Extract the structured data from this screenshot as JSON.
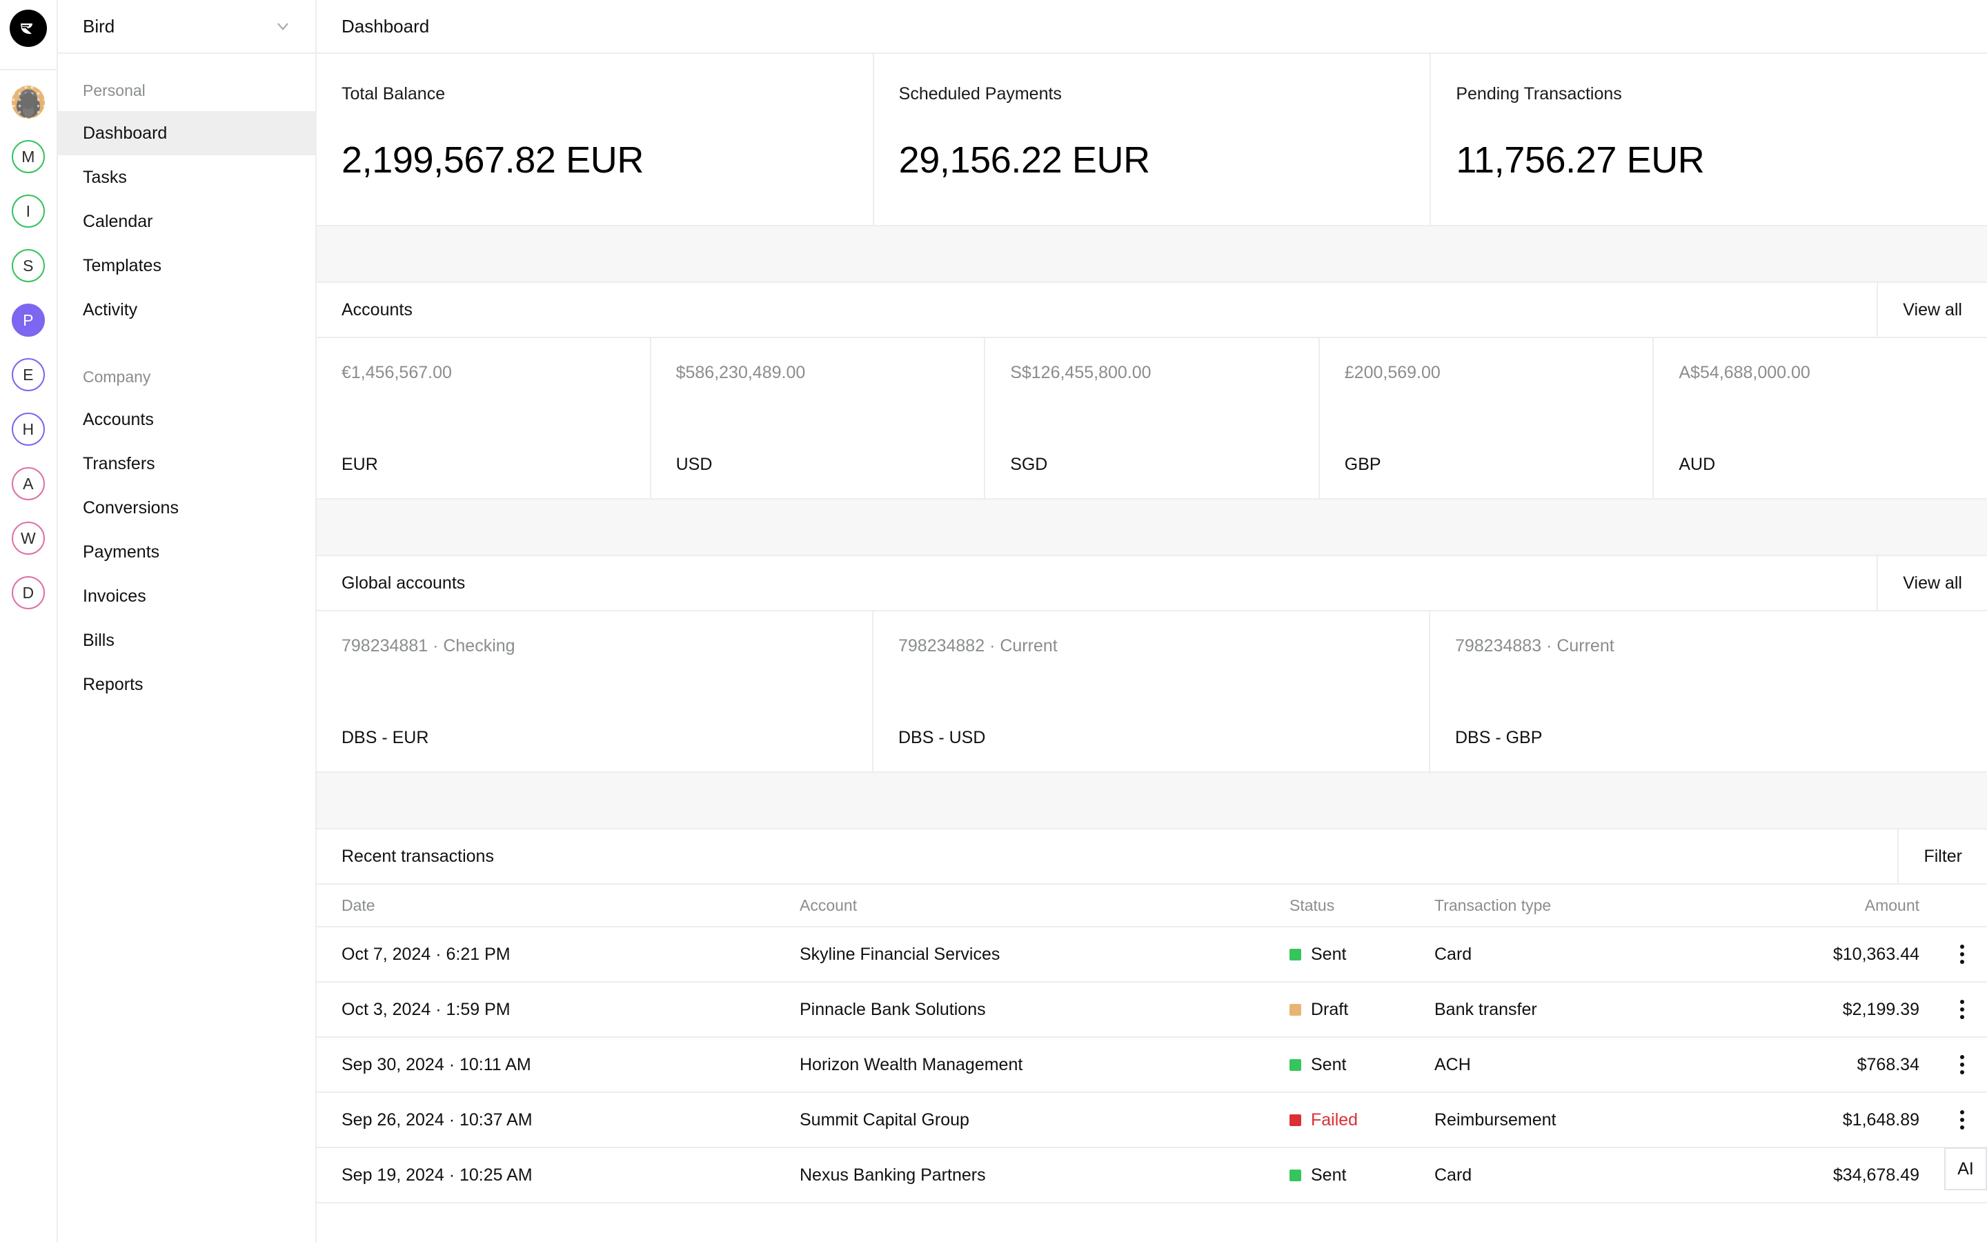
{
  "rail": {
    "logo_icon": "bird-logo-icon",
    "user_avatar": "user-avatar-photo",
    "avatars": [
      {
        "initial": "M",
        "style": "green"
      },
      {
        "initial": "I",
        "style": "green"
      },
      {
        "initial": "S",
        "style": "green"
      },
      {
        "initial": "P",
        "style": "filled-violet"
      },
      {
        "initial": "E",
        "style": "violet"
      },
      {
        "initial": "H",
        "style": "violet"
      },
      {
        "initial": "A",
        "style": "pink"
      },
      {
        "initial": "W",
        "style": "pink"
      },
      {
        "initial": "D",
        "style": "pink"
      }
    ]
  },
  "sidebar": {
    "workspace": "Bird",
    "workspace_chevron_icon": "chevron-down-icon",
    "groups": [
      {
        "label": "Personal",
        "items": [
          {
            "label": "Dashboard",
            "active": true
          },
          {
            "label": "Tasks",
            "active": false
          },
          {
            "label": "Calendar",
            "active": false
          },
          {
            "label": "Templates",
            "active": false
          },
          {
            "label": "Activity",
            "active": false
          }
        ]
      },
      {
        "label": "Company",
        "items": [
          {
            "label": "Accounts",
            "active": false
          },
          {
            "label": "Transfers",
            "active": false
          },
          {
            "label": "Conversions",
            "active": false
          },
          {
            "label": "Payments",
            "active": false
          },
          {
            "label": "Invoices",
            "active": false
          },
          {
            "label": "Bills",
            "active": false
          },
          {
            "label": "Reports",
            "active": false
          }
        ]
      }
    ]
  },
  "topbar": {
    "title": "Dashboard"
  },
  "stats": [
    {
      "label": "Total Balance",
      "value": "2,199,567.82 EUR"
    },
    {
      "label": "Scheduled Payments",
      "value": "29,156.22 EUR"
    },
    {
      "label": "Pending Transactions",
      "value": "11,756.27 EUR"
    }
  ],
  "accounts_section": {
    "title": "Accounts",
    "action": "View all",
    "cards": [
      {
        "amount": "€1,456,567.00",
        "currency": "EUR"
      },
      {
        "amount": "$586,230,489.00",
        "currency": "USD"
      },
      {
        "amount": "S$126,455,800.00",
        "currency": "SGD"
      },
      {
        "amount": "£200,569.00",
        "currency": "GBP"
      },
      {
        "amount": "A$54,688,000.00",
        "currency": "AUD"
      }
    ]
  },
  "global_accounts_section": {
    "title": "Global accounts",
    "action": "View all",
    "cards": [
      {
        "reference": "798234881 · Checking",
        "name": "DBS - EUR"
      },
      {
        "reference": "798234882 · Current",
        "name": "DBS - USD"
      },
      {
        "reference": "798234883 · Current",
        "name": "DBS - GBP"
      }
    ]
  },
  "transactions_section": {
    "title": "Recent transactions",
    "action": "Filter",
    "columns": [
      "Date",
      "Account",
      "Status",
      "Transaction type",
      "Amount"
    ],
    "rows": [
      {
        "date": "Oct 7, 2024 · 6:21 PM",
        "account": "Skyline Financial Services",
        "status": "Sent",
        "status_color": "#36c45d",
        "type": "Card",
        "amount": "$10,363.44"
      },
      {
        "date": "Oct 3, 2024 · 1:59 PM",
        "account": "Pinnacle Bank Solutions",
        "status": "Draft",
        "status_color": "#e8b474",
        "type": "Bank transfer",
        "amount": "$2,199.39"
      },
      {
        "date": "Sep 30, 2024 · 10:11 AM",
        "account": "Horizon Wealth Management",
        "status": "Sent",
        "status_color": "#36c45d",
        "type": "ACH",
        "amount": "$768.34"
      },
      {
        "date": "Sep 26, 2024 · 10:37 AM",
        "account": "Summit Capital Group",
        "status": "Failed",
        "status_color": "#dc2f33",
        "type": "Reimbursement",
        "amount": "$1,648.89"
      },
      {
        "date": "Sep 19, 2024 · 10:25 AM",
        "account": "Nexus Banking Partners",
        "status": "Sent",
        "status_color": "#36c45d",
        "type": "Card",
        "amount": "$34,678.49"
      }
    ]
  },
  "ai_button": {
    "label": "AI"
  },
  "colors": {
    "border": "#eceded",
    "band": "#f7f7f7",
    "active_nav": "#eeeeee",
    "muted_text": "#8a8d8f",
    "green": "#36c45d",
    "amber": "#e8b474",
    "red": "#dc2f33",
    "violet": "#7d66f0",
    "pink": "#e06fa8"
  }
}
